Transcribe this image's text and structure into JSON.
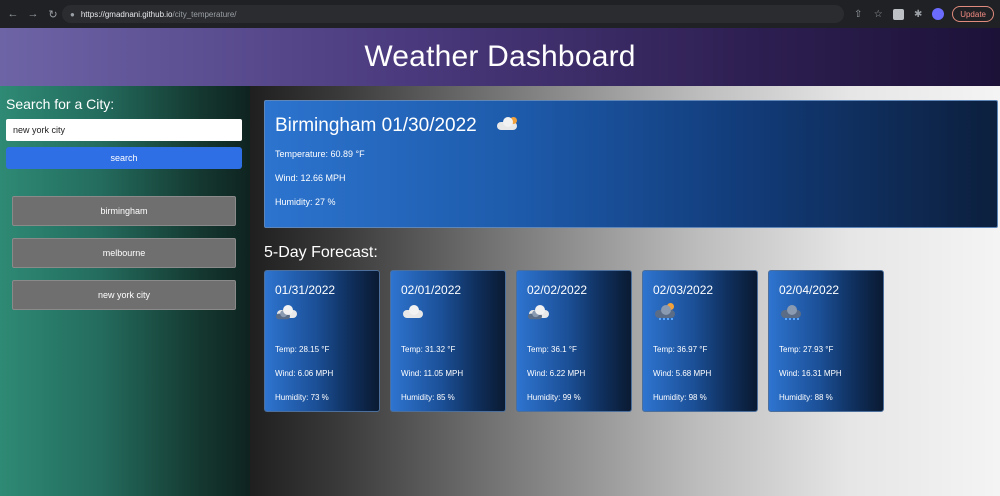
{
  "browser": {
    "url_host": "https://gmadnani.github.io",
    "url_path": "/city_temperature/",
    "update_label": "Update"
  },
  "header": {
    "title": "Weather Dashboard"
  },
  "sidebar": {
    "title": "Search for a City:",
    "search_value": "new york city",
    "search_button": "search",
    "history": [
      "birmingham",
      "melbourne",
      "new york city"
    ]
  },
  "current": {
    "title": "Birmingham 01/30/2022",
    "icon": "partly-cloudy-icon",
    "temperature": "Temperature: 60.89 °F",
    "wind": "Wind: 12.66 MPH",
    "humidity": "Humidity: 27 %"
  },
  "forecast": {
    "title": "5-Day Forecast:",
    "days": [
      {
        "date": "01/31/2022",
        "icon": "cloudy-icon",
        "temp": "Temp: 28.15 °F",
        "wind": "Wind: 6.06 MPH",
        "humidity": "Humidity: 73 %"
      },
      {
        "date": "02/01/2022",
        "icon": "cloud-icon",
        "temp": "Temp: 31.32 °F",
        "wind": "Wind: 11.05 MPH",
        "humidity": "Humidity: 85 %"
      },
      {
        "date": "02/02/2022",
        "icon": "cloudy-icon",
        "temp": "Temp: 36.1 °F",
        "wind": "Wind: 6.22 MPH",
        "humidity": "Humidity: 99 %"
      },
      {
        "date": "02/03/2022",
        "icon": "rain-sun-icon",
        "temp": "Temp: 36.97 °F",
        "wind": "Wind: 5.68 MPH",
        "humidity": "Humidity: 98 %"
      },
      {
        "date": "02/04/2022",
        "icon": "rain-cloud-icon",
        "temp": "Temp: 27.93 °F",
        "wind": "Wind: 16.31 MPH",
        "humidity": "Humidity: 88 %"
      }
    ]
  }
}
